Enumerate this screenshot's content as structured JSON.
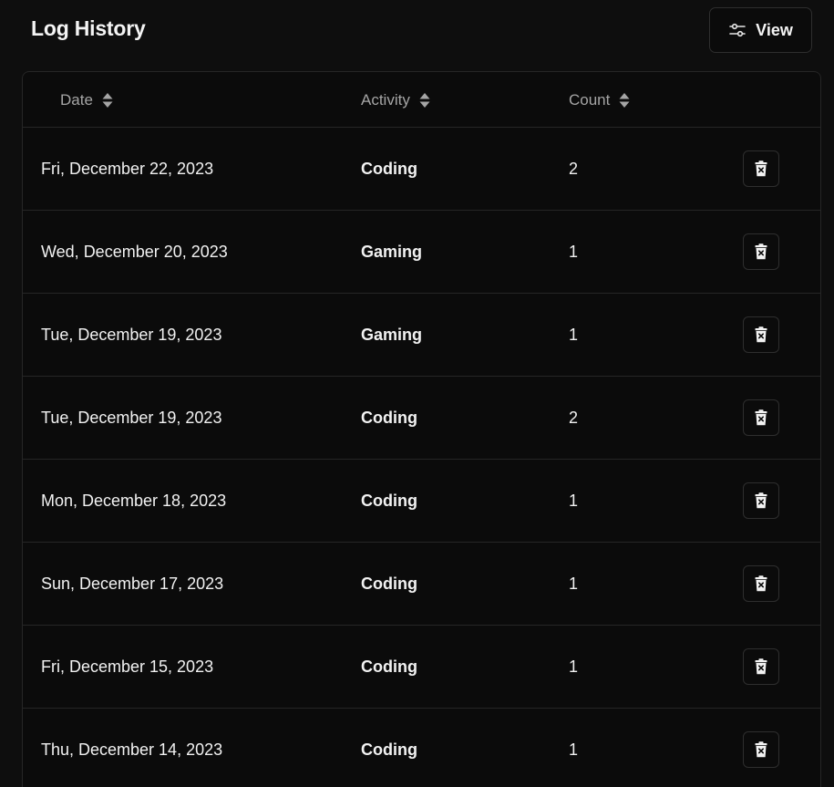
{
  "header": {
    "title": "Log History",
    "view_button_label": "View",
    "view_icon": "sliders-icon"
  },
  "table": {
    "columns": [
      "Date",
      "Activity",
      "Count"
    ],
    "sort_icon": "sort-updown-icon",
    "delete_icon": "trash-x-icon",
    "rows": [
      {
        "date": "Fri, December 22, 2023",
        "activity": "Coding",
        "count": "2"
      },
      {
        "date": "Wed, December 20, 2023",
        "activity": "Gaming",
        "count": "1"
      },
      {
        "date": "Tue, December 19, 2023",
        "activity": "Gaming",
        "count": "1"
      },
      {
        "date": "Tue, December 19, 2023",
        "activity": "Coding",
        "count": "2"
      },
      {
        "date": "Mon, December 18, 2023",
        "activity": "Coding",
        "count": "1"
      },
      {
        "date": "Sun, December 17, 2023",
        "activity": "Coding",
        "count": "1"
      },
      {
        "date": "Fri, December 15, 2023",
        "activity": "Coding",
        "count": "1"
      },
      {
        "date": "Thu, December 14, 2023",
        "activity": "Coding",
        "count": "1"
      }
    ]
  },
  "colors": {
    "background": "#0e0e0e",
    "card": "#0b0b0b",
    "border": "#262626",
    "text": "#f2f2f2",
    "muted": "#a5a5a5"
  }
}
